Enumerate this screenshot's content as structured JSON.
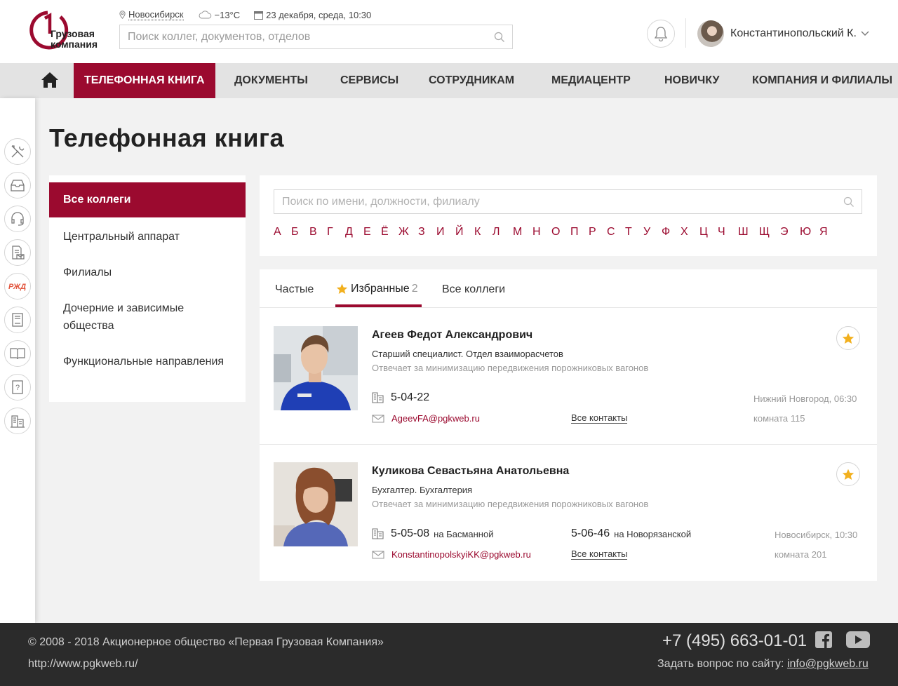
{
  "header": {
    "logo_line1": "Грузовая",
    "logo_line2": "компания",
    "city": "Новосибирск",
    "weather": "−13°C",
    "datetime": "23 декабря, среда, 10:30",
    "search_placeholder": "Поиск коллег, документов, отделов",
    "user_name": "Константинопольский К."
  },
  "nav": {
    "items": [
      "ТЕЛЕФОННАЯ КНИГА",
      "ДОКУМЕНТЫ",
      "СЕРВИСЫ",
      "СОТРУДНИКАМ",
      "МЕДИАЦЕНТР",
      "НОВИЧКУ",
      "КОМПАНИЯ И ФИЛИАЛЫ"
    ],
    "active_index": 0
  },
  "page": {
    "title": "Телефонная книга"
  },
  "sidebar": {
    "items": [
      "Все коллеги",
      "Центральный аппарат",
      "Филиалы",
      "Дочерние и зависимые",
      "общества",
      "Функциональные направления"
    ]
  },
  "search": {
    "placeholder": "Поиск по имени, должности, филиалу",
    "letters": [
      "А",
      "Б",
      "В",
      "Г",
      "Д",
      "Е",
      "Ё",
      "Ж",
      "З",
      "И",
      "Й",
      "К",
      "Л",
      "М",
      "Н",
      "О",
      "П",
      "Р",
      "С",
      "Т",
      "У",
      "Ф",
      "Х",
      "Ц",
      "Ч",
      "Ш",
      "Щ",
      "Э",
      "Ю",
      "Я"
    ]
  },
  "tabs": {
    "frequent": "Частые",
    "favorites": "Избранные",
    "favorites_count": "2",
    "all": "Все коллеги"
  },
  "people": [
    {
      "name": "Агеев Федот Александрович",
      "position": "Старший специалист. Отдел взаиморасчетов",
      "responsibility": "Отвечает за минимизацию передвижения порожниковых вагонов",
      "phone": "5-04-22",
      "email": "AgeevFA@pgkweb.ru",
      "all_contacts": "Все контакты",
      "city": "Нижний Новгород, 06:30",
      "room": "комната 115"
    },
    {
      "name": "Куликова Севастьяна Анатольевна",
      "position": "Бухгалтер. Бухгалтерия",
      "responsibility": "Отвечает за минимизацию передвижения порожниковых вагонов",
      "phone": "5-05-08",
      "phone_loc": "на Басманной",
      "phone2": "5-06-46",
      "phone2_loc": "на Новорязанской",
      "email": "KonstantinopolskyiKK@pgkweb.ru",
      "all_contacts": "Все контакты",
      "city": "Новосибирск, 10:30",
      "room": "комната 201"
    }
  ],
  "footer": {
    "copyright": "© 2008 - 2018 Акционерное общество «Первая Грузовая Компания»",
    "site": "http://www.pgkweb.ru/",
    "phone": "+7 (495) 663-01-01",
    "ask_label": "Задать вопрос по сайту:",
    "ask_email": "info@pgkweb.ru"
  },
  "colors": {
    "brand": "#9b0a2f",
    "star": "#f2b01e",
    "footer_bg": "#2b2b2b"
  }
}
